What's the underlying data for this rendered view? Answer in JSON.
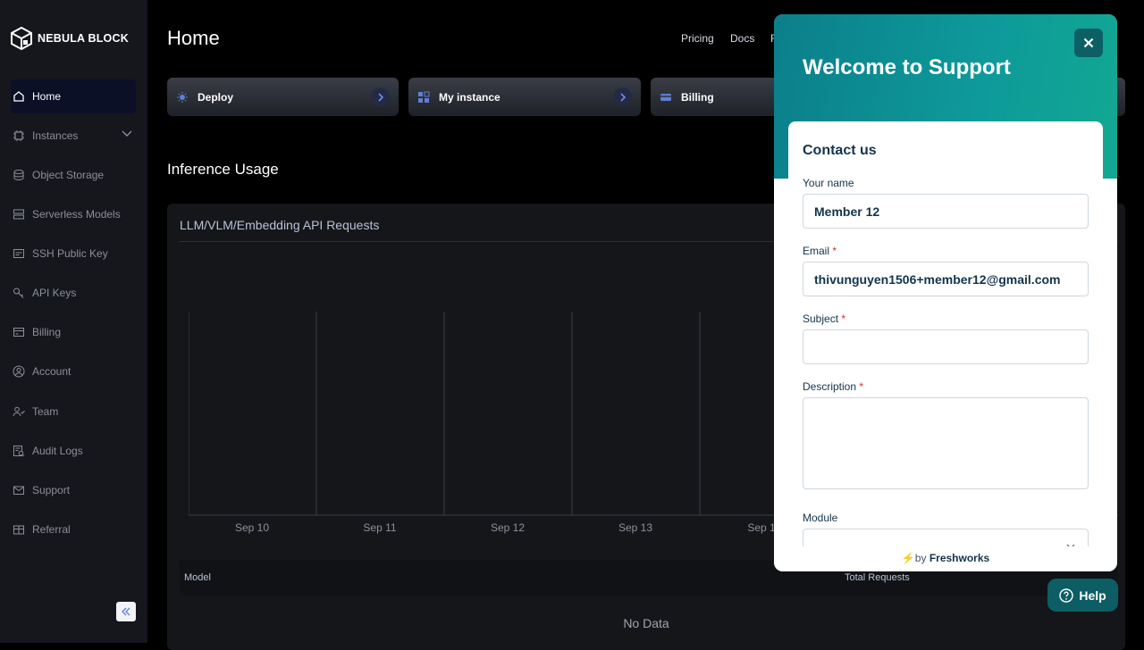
{
  "sidebar": {
    "logo_text": "NEBULA BLOCK",
    "items": [
      {
        "label": "Home",
        "icon": "home-icon"
      },
      {
        "label": "Instances",
        "icon": "chip-icon"
      },
      {
        "label": "Object Storage",
        "icon": "database-icon"
      },
      {
        "label": "Serverless Models",
        "icon": "server-icon"
      },
      {
        "label": "SSH Public Key",
        "icon": "ssh-key-icon"
      },
      {
        "label": "API Keys",
        "icon": "key-icon"
      },
      {
        "label": "Billing",
        "icon": "billing-icon"
      },
      {
        "label": "Account",
        "icon": "user-icon"
      },
      {
        "label": "Team",
        "icon": "team-icon"
      },
      {
        "label": "Audit Logs",
        "icon": "audit-log-icon"
      },
      {
        "label": "Support",
        "icon": "mail-icon"
      },
      {
        "label": "Referral",
        "icon": "gift-icon"
      }
    ]
  },
  "header": {
    "title": "Home",
    "nav": [
      "Pricing",
      "Docs",
      "F"
    ]
  },
  "quick_actions": [
    {
      "label": "Deploy",
      "icon": "deploy-icon"
    },
    {
      "label": "My instance",
      "icon": "grid-icon"
    },
    {
      "label": "Billing",
      "icon": "card-icon"
    }
  ],
  "usage": {
    "section_title": "Inference Usage",
    "card_title": "LLM/VLM/Embedding API Requests",
    "x_ticks": [
      "Sep 10",
      "Sep 11",
      "Sep 12",
      "Sep 13",
      "Sep 1"
    ],
    "table_headers": [
      "Model",
      "Total Requests"
    ],
    "empty_text": "No Data"
  },
  "support_widget": {
    "title": "Welcome to Support",
    "form_title": "Contact us",
    "fields": {
      "name_label": "Your name",
      "name_value": "Member 12",
      "email_label": "Email",
      "email_value": "thivunguyen1506+member12@gmail.com",
      "subject_label": "Subject",
      "description_label": "Description",
      "module_label": "Module",
      "module_value": "--",
      "required_mark": "*"
    },
    "footer_prefix": "by",
    "footer_brand": "Freshworks",
    "help_label": "Help",
    "colors": {
      "header_start": "#0b7f8a",
      "header_end": "#12a892",
      "button": "#0d5e64"
    }
  }
}
